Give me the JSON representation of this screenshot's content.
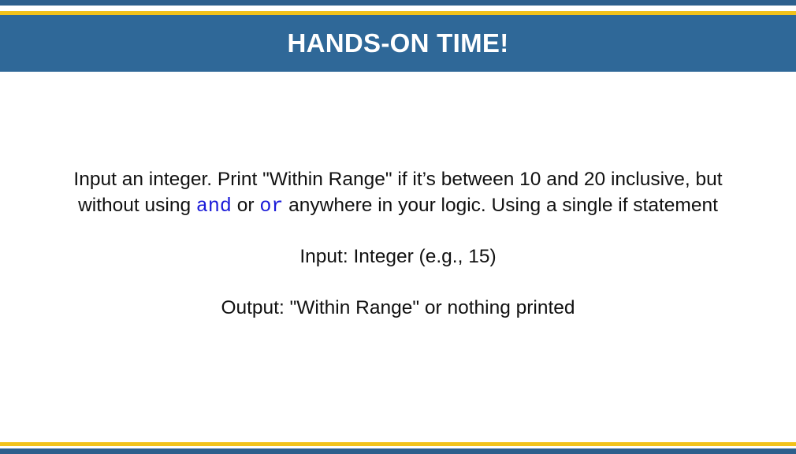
{
  "slide": {
    "title": "HANDS-ON TIME!",
    "task": {
      "part1": "Input an integer. Print \"Within Range\" if it’s between 10 and 20 inclusive, but without using ",
      "keyword_and": "and",
      "part2": " or ",
      "keyword_or": "or",
      "part3": " anywhere in your logic. Using a single if statement"
    },
    "input_line": "Input: Integer (e.g., 15)",
    "output_line": "Output: \"Within Range\" or nothing printed"
  },
  "colors": {
    "header_blue": "#2f6898",
    "accent_gold": "#f2c21b",
    "keyword_blue": "#1a1ad8",
    "text": "#111111"
  }
}
